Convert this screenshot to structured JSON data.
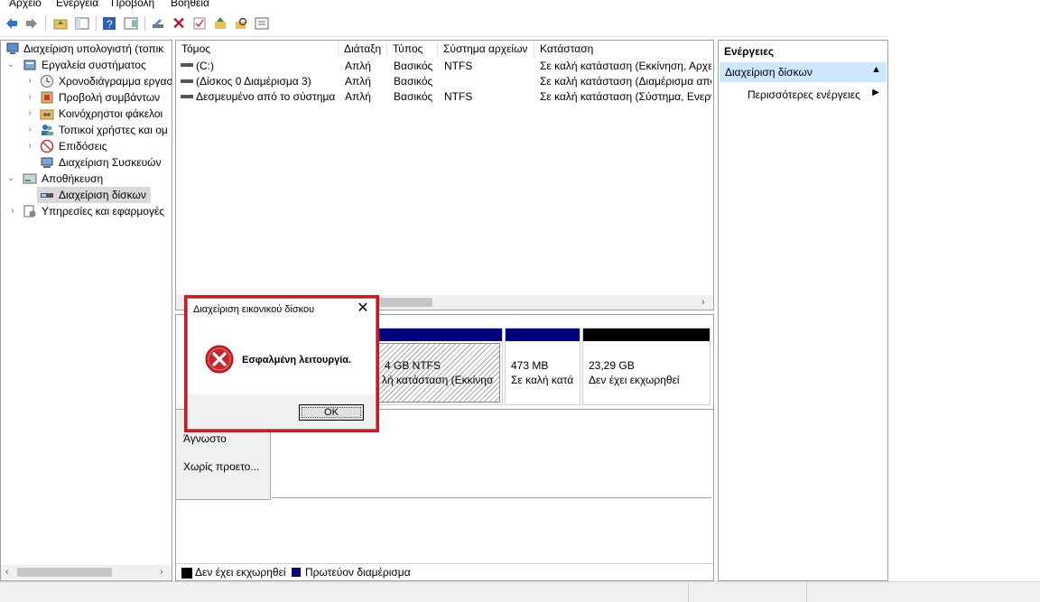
{
  "menu": {
    "file": "Αρχείο",
    "action": "Ενέργεια",
    "view": "Προβολή",
    "help": "Βοήθεια"
  },
  "tree": {
    "root": "Διαχείριση υπολογιστή (τοπικ",
    "system_tools": "Εργαλεία συστήματος",
    "task_scheduler": "Χρονοδιάγραμμα εργασ",
    "event_viewer": "Προβολή συμβάντων",
    "shared_folders": "Κοινόχρηστοι φάκελοι",
    "local_users": "Τοπικοί χρήστες και ομ",
    "performance": "Επιδόσεις",
    "device_manager": "Διαχείριση Συσκευών",
    "storage": "Αποθήκευση",
    "disk_management": "Διαχείριση δίσκων",
    "services": "Υπηρεσίες και εφαρμογές"
  },
  "volume_list": {
    "headers": [
      "Τόμος",
      "Διάταξη",
      "Τύπος",
      "Σύστημα αρχείων",
      "Κατάσταση"
    ],
    "rows": [
      [
        "(C:)",
        "Απλή",
        "Βασικός",
        "NTFS",
        "Σε καλή κατάσταση (Εκκίνηση, Αρχε"
      ],
      [
        "(Δίσκος 0 Διαμέρισμα 3)",
        "Απλή",
        "Βασικός",
        "",
        "Σε καλή κατάσταση (Διαμέρισμα απο"
      ],
      [
        "Δεσμευμένο από το σύστημα",
        "Απλή",
        "Βασικός",
        "NTFS",
        "Σε καλή κατάσταση (Σύστημα, Ενεργ"
      ]
    ]
  },
  "disk": {
    "partitions": [
      {
        "size": "4 GB NTFS",
        "status": "λή κατάσταση (Εκκίνησ"
      },
      {
        "size": "473 MB",
        "status": "Σε καλή κατά"
      },
      {
        "size": "23,29 GB",
        "status": "Δεν έχει εκχωρηθεί"
      }
    ],
    "cdrom_status": "Άγνωστο",
    "cdrom_media": "Χωρίς προετο..."
  },
  "legend": {
    "unallocated": "Δεν έχει εκχωρηθεί",
    "primary": "Πρωτεύον διαμέρισμα"
  },
  "actions": {
    "header": "Ενέργειες",
    "section": "Διαχείριση δίσκων",
    "more": "Περισσότερες ενέργειες"
  },
  "dialog": {
    "title": "Διαχείριση εικονικού δίσκου",
    "message": "Εσφαλμένη λειτουργία.",
    "ok": "OK"
  },
  "colors": {
    "primary_partition": "#00007f",
    "unallocated": "#000000",
    "highlight": "#e3101b",
    "selection": "#cce8ff"
  }
}
